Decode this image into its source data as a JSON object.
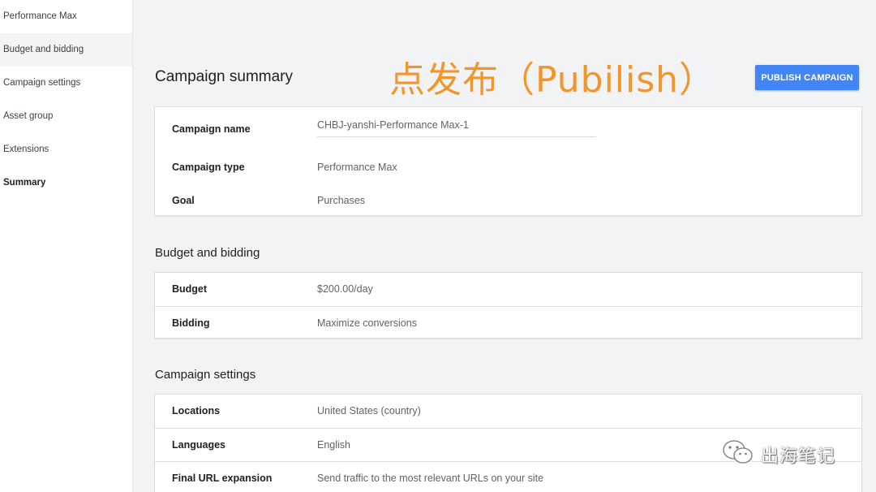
{
  "sidebar": {
    "items": [
      {
        "label": "Performance Max"
      },
      {
        "label": "Budget and bidding"
      },
      {
        "label": "Campaign settings"
      },
      {
        "label": "Asset group"
      },
      {
        "label": "Extensions"
      },
      {
        "label": "Summary"
      }
    ]
  },
  "header": {
    "title": "Campaign summary",
    "overlay_annotation": "点发布（Pubilish）",
    "publish_label": "PUBLISH CAMPAIGN"
  },
  "summary_card": {
    "rows": [
      {
        "label": "Campaign name",
        "value": "CHBJ-yanshi-Performance Max-1"
      },
      {
        "label": "Campaign type",
        "value": "Performance Max"
      },
      {
        "label": "Goal",
        "value": "Purchases"
      }
    ]
  },
  "budget_section": {
    "title": "Budget and bidding",
    "rows": [
      {
        "label": "Budget",
        "value": "$200.00/day"
      },
      {
        "label": "Bidding",
        "value": "Maximize conversions"
      }
    ]
  },
  "settings_section": {
    "title": "Campaign settings",
    "rows": [
      {
        "label": "Locations",
        "value": "United States (country)"
      },
      {
        "label": "Languages",
        "value": "English"
      },
      {
        "label": "Final URL expansion",
        "value": "Send traffic to the most relevant URLs on your site"
      }
    ]
  },
  "watermark": {
    "text": "出海笔记",
    "icon": "wechat-icon"
  },
  "colors": {
    "accent": "#4285f4",
    "annotation": "#f0962d"
  }
}
